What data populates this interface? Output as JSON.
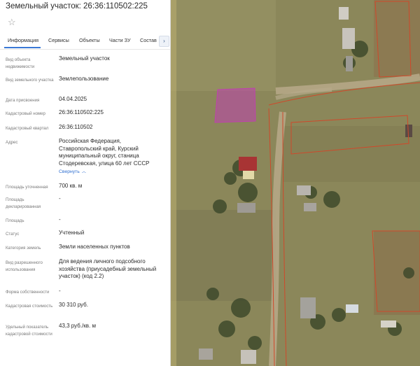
{
  "panel": {
    "title": "Земельный участок: 26:36:110502:225",
    "tabs": [
      {
        "label": "Информация"
      },
      {
        "label": "Сервисы"
      },
      {
        "label": "Объекты"
      },
      {
        "label": "Части ЗУ"
      },
      {
        "label": "Состав"
      }
    ],
    "tab_more": "›",
    "fields": [
      {
        "label": "Вид объекта недвижимости",
        "value": "Земельный участок"
      },
      {
        "label": "Вид земельного участка",
        "value": "Землепользование"
      },
      {
        "label": "Дата присвоения",
        "value": "04.04.2025"
      },
      {
        "label": "Кадастровый номер",
        "value": "26:36:110502:225"
      },
      {
        "label": "Кадастровый квартал",
        "value": "26:36:110502"
      },
      {
        "label": "Адрес",
        "value": "Российская Федерация, Ставропольский край, Курский муниципальный округ, станица Стодеревская, улица 60 лет СССР",
        "link": "Свернуть"
      },
      {
        "label": "Площадь уточненная",
        "value": "700 кв. м"
      },
      {
        "label": "Площадь декларированная",
        "value": "-"
      },
      {
        "label": "Площадь",
        "value": "-"
      },
      {
        "label": "Статус",
        "value": "Учтенный"
      },
      {
        "label": "Категория земель",
        "value": "Земли населенных пунктов"
      },
      {
        "label": "Вид разрешенного использования",
        "value": "Для ведения личного подсобного хозяйства (приусадебный земельный участок) (код 2.2)"
      },
      {
        "label": "Форма собственности",
        "value": "-"
      },
      {
        "label": "Кадастровая стоимость",
        "value": "30 310 руб."
      },
      {
        "label": "Удельный показатель кадастровой стоимости",
        "value": "43,3 руб./кв. м"
      }
    ]
  },
  "colors": {
    "accent": "#3a78d6",
    "parcel_highlight": "#c040b0",
    "parcel_border": "#d0482a"
  }
}
